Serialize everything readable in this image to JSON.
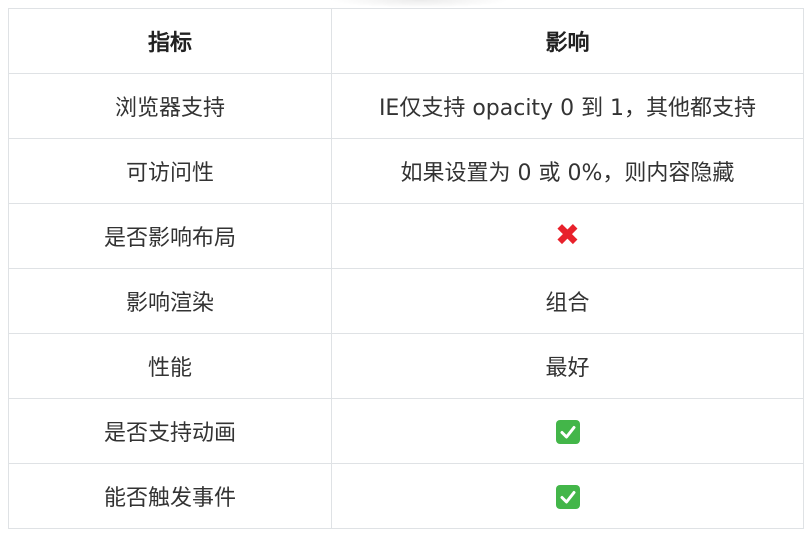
{
  "table": {
    "headers": [
      "指标",
      "影响"
    ],
    "rows": [
      {
        "metric": "浏览器支持",
        "impact": "IE仅支持 opacity 0 到 1，其他都支持",
        "impact_type": "text"
      },
      {
        "metric": "可访问性",
        "impact": "如果设置为 0 或 0%，则内容隐藏",
        "impact_type": "text"
      },
      {
        "metric": "是否影响布局",
        "impact": "✖",
        "impact_type": "cross-icon"
      },
      {
        "metric": "影响渲染",
        "impact": "组合",
        "impact_type": "text"
      },
      {
        "metric": "性能",
        "impact": "最好",
        "impact_type": "text"
      },
      {
        "metric": "是否支持动画",
        "impact": "✔",
        "impact_type": "check-icon"
      },
      {
        "metric": "能否触发事件",
        "impact": "✔",
        "impact_type": "check-icon"
      }
    ]
  },
  "colors": {
    "border": "#dfe2e5",
    "cross": "#e8212b",
    "check_bg": "#43b649"
  }
}
